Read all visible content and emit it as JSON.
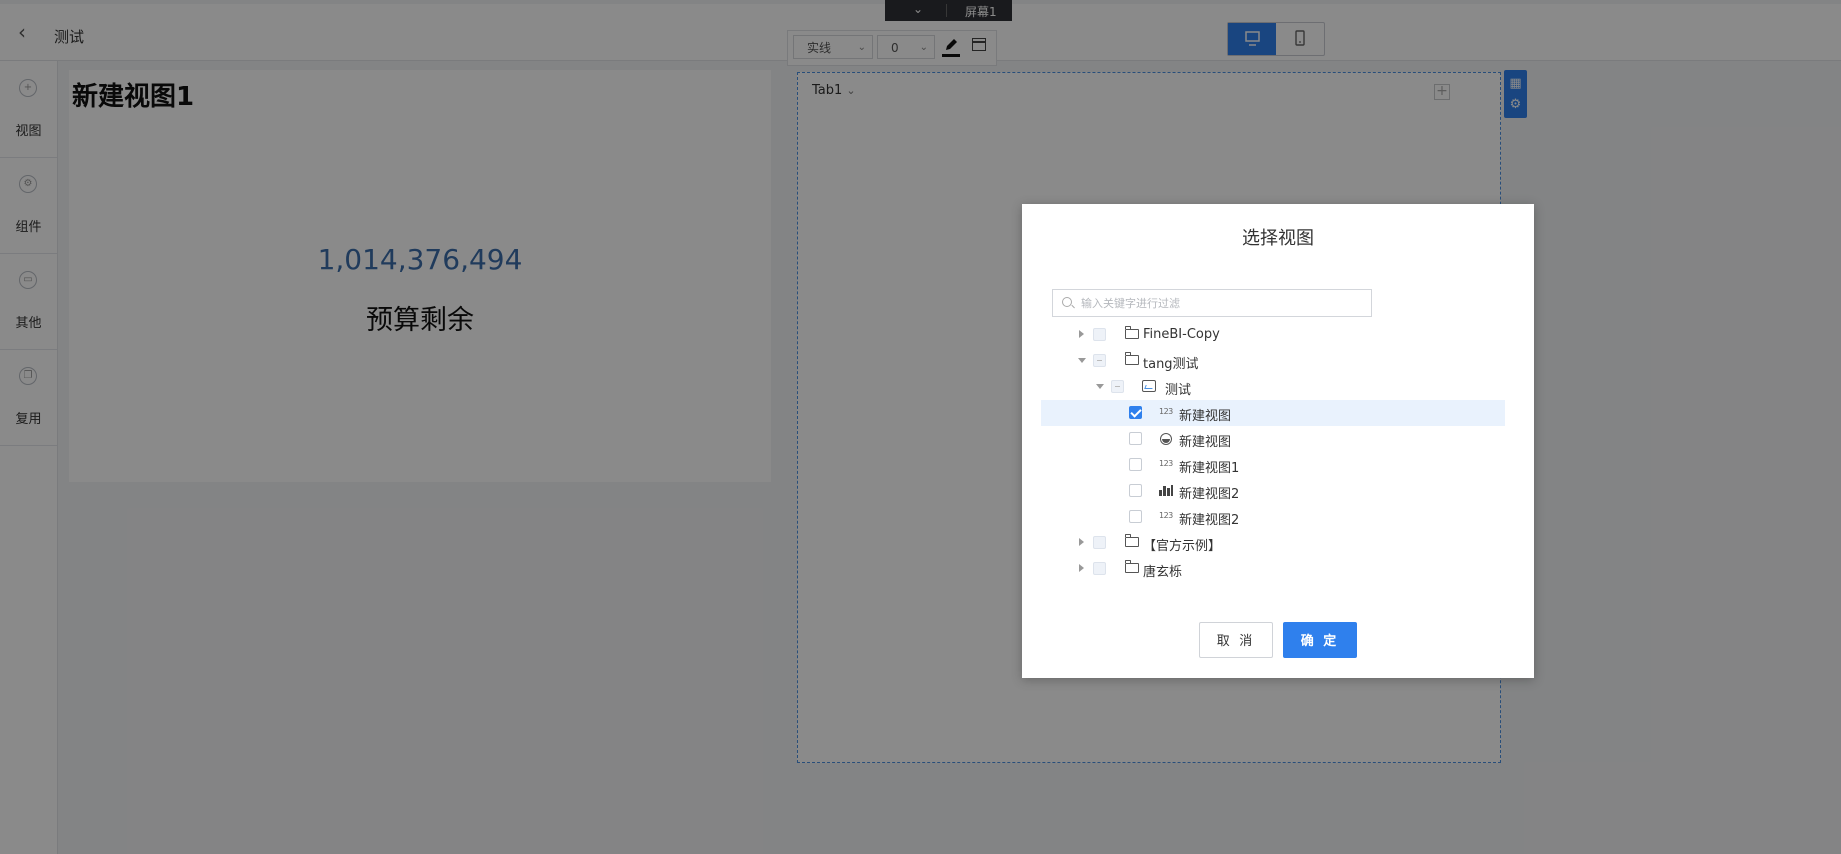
{
  "header": {
    "title": "测试",
    "screen_tab": "屏幕1"
  },
  "sidebar": {
    "items": [
      {
        "label": "视图",
        "icon": "plus-circle-icon"
      },
      {
        "label": "组件",
        "icon": "gear-circle-icon"
      },
      {
        "label": "其他",
        "icon": "box-circle-icon"
      },
      {
        "label": "复用",
        "icon": "copy-circle-icon"
      }
    ]
  },
  "view_card": {
    "title": "新建视图1",
    "kpi_value": "1,014,376,494",
    "kpi_label": "预算剩余"
  },
  "style_toolbar": {
    "line_style": "实线",
    "line_width": "0"
  },
  "tab_container": {
    "tab_label": "Tab1"
  },
  "dialog": {
    "title": "选择视图",
    "search_placeholder": "输入关键字进行过滤",
    "tree": [
      {
        "label": "FineBI-Copy",
        "level": 0,
        "type": "folder",
        "expanded": false,
        "state": "unchecked"
      },
      {
        "label": "tang测试",
        "level": 0,
        "type": "folder",
        "expanded": true,
        "state": "partial"
      },
      {
        "label": "测试",
        "level": 1,
        "type": "dashboard",
        "expanded": true,
        "state": "partial"
      },
      {
        "label": "新建视图",
        "level": 2,
        "type": "number-view",
        "state": "checked"
      },
      {
        "label": "新建视图",
        "level": 2,
        "type": "pie-view",
        "state": "unchecked"
      },
      {
        "label": "新建视图1",
        "level": 2,
        "type": "number-view",
        "state": "unchecked"
      },
      {
        "label": "新建视图2",
        "level": 2,
        "type": "bar-view",
        "state": "unchecked"
      },
      {
        "label": "新建视图2",
        "level": 2,
        "type": "number-view",
        "state": "unchecked"
      },
      {
        "label": "【官方示例】",
        "level": 0,
        "type": "folder",
        "expanded": false,
        "state": "unchecked"
      },
      {
        "label": "唐玄栎",
        "level": 0,
        "type": "folder",
        "expanded": false,
        "state": "unchecked"
      }
    ],
    "number_icon_text": "123",
    "cancel_label": "取 消",
    "ok_label": "确 定"
  },
  "colors": {
    "accent": "#2f80ed",
    "kpi": "#3c6eaa",
    "selected_row": "#e9f2fd"
  }
}
